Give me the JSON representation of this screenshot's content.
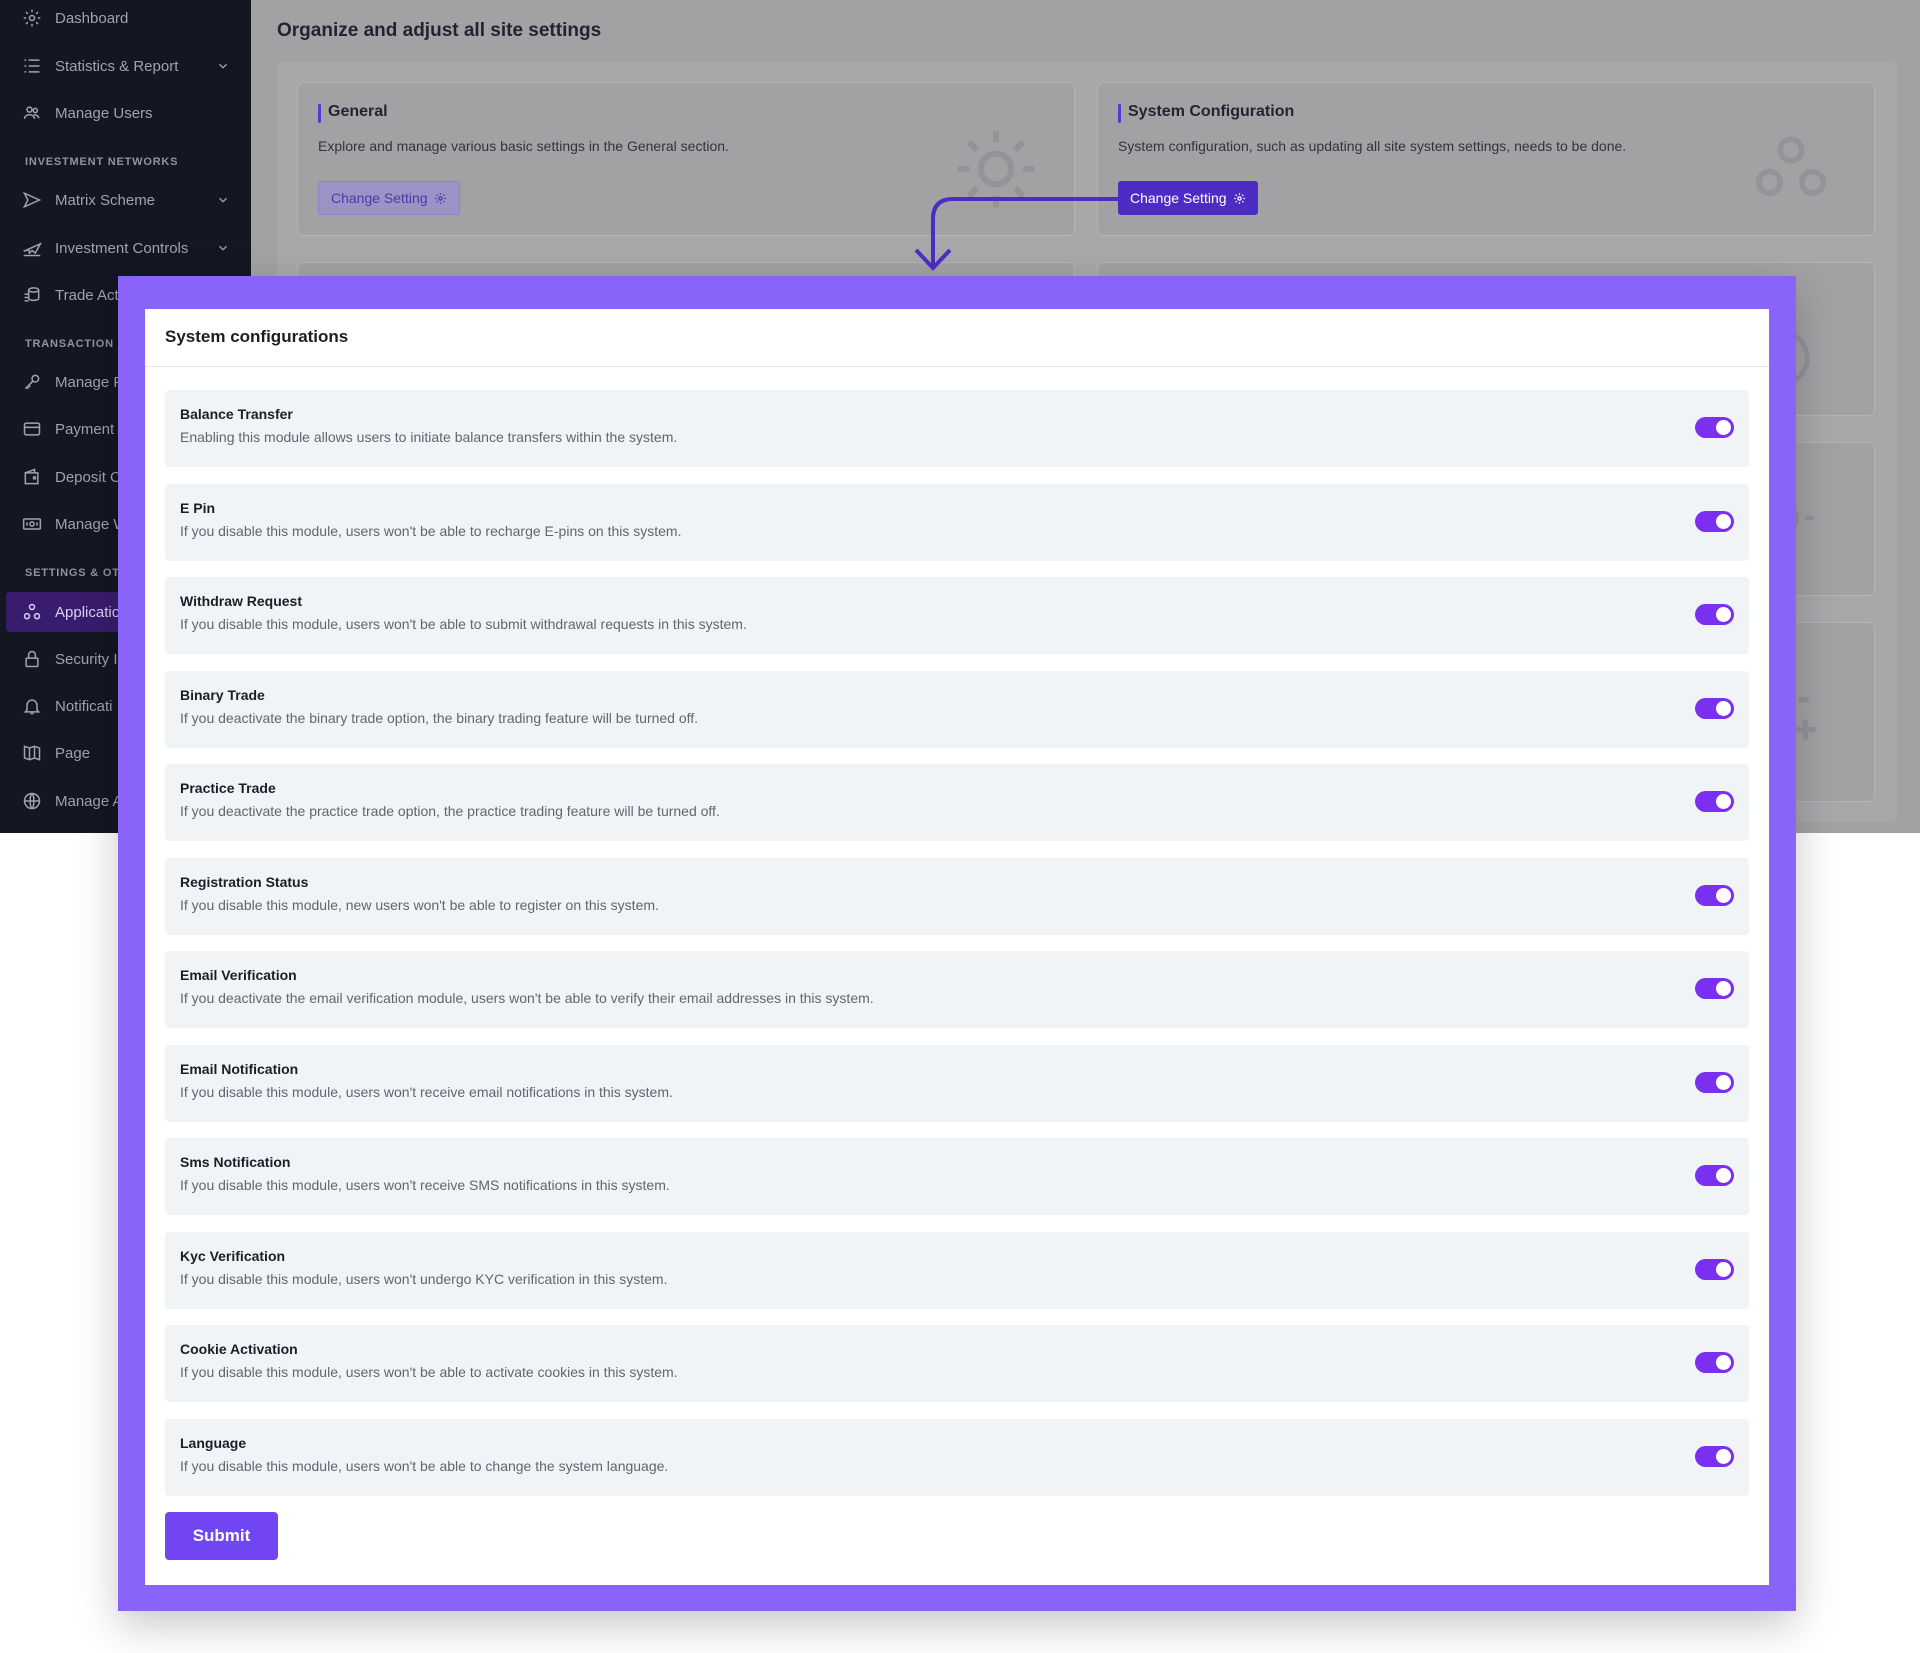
{
  "sidebar": {
    "items": [
      {
        "label": "Dashboard",
        "icon": "gear-icon",
        "chevron": false
      },
      {
        "label": "Statistics & Report",
        "icon": "list-icon",
        "chevron": true
      },
      {
        "label": "Manage Users",
        "icon": "users-icon",
        "chevron": false
      },
      {
        "label": "Matrix Scheme",
        "icon": "send-icon",
        "chevron": true
      },
      {
        "label": "Investment Controls",
        "icon": "plane-icon",
        "chevron": true
      },
      {
        "label": "Trade Act",
        "icon": "coins-icon",
        "chevron": false
      },
      {
        "label": "Manage P",
        "icon": "key-icon",
        "chevron": false
      },
      {
        "label": "Payment",
        "icon": "card-icon",
        "chevron": false
      },
      {
        "label": "Deposit C",
        "icon": "wallet-icon",
        "chevron": false
      },
      {
        "label": "Manage W",
        "icon": "cash-icon",
        "chevron": false
      },
      {
        "label": "Applicatio",
        "icon": "apps-icon",
        "chevron": false,
        "active": true
      },
      {
        "label": "Security I",
        "icon": "lock-icon",
        "chevron": false
      },
      {
        "label": "Notificati",
        "icon": "bell-icon",
        "chevron": false
      },
      {
        "label": "Page",
        "icon": "pages-icon",
        "chevron": false
      },
      {
        "label": "Manage A",
        "icon": "globe-icon",
        "chevron": false
      }
    ],
    "sections": {
      "investment": "INVESTMENT NETWORKS",
      "transaction": "TRANSACTION S",
      "settings": "SETTINGS & OTH"
    }
  },
  "main": {
    "title": "Organize and adjust all site settings",
    "cards": [
      {
        "title": "General",
        "description": "Explore and manage various basic settings in the General section.",
        "button": "Change Setting"
      },
      {
        "title": "System Configuration",
        "description": "System configuration, such as updating all site system settings, needs to be done.",
        "button": "Change Setting"
      }
    ]
  },
  "modal": {
    "title": "System configurations",
    "rows": [
      {
        "title": "Balance Transfer",
        "description": "Enabling this module allows users to initiate balance transfers within the system.",
        "enabled": true
      },
      {
        "title": "E Pin",
        "description": "If you disable this module, users won't be able to recharge E-pins on this system.",
        "enabled": true
      },
      {
        "title": "Withdraw Request",
        "description": "If you disable this module, users won't be able to submit withdrawal requests in this system.",
        "enabled": true
      },
      {
        "title": "Binary Trade",
        "description": "If you deactivate the binary trade option, the binary trading feature will be turned off.",
        "enabled": true
      },
      {
        "title": "Practice Trade",
        "description": "If you deactivate the practice trade option, the practice trading feature will be turned off.",
        "enabled": true
      },
      {
        "title": "Registration Status",
        "description": "If you disable this module, new users won't be able to register on this system.",
        "enabled": true
      },
      {
        "title": "Email Verification",
        "description": "If you deactivate the email verification module, users won't be able to verify their email addresses in this system.",
        "enabled": true
      },
      {
        "title": "Email Notification",
        "description": "If you disable this module, users won't receive email notifications in this system.",
        "enabled": true
      },
      {
        "title": "Sms Notification",
        "description": "If you disable this module, users won't receive SMS notifications in this system.",
        "enabled": true
      },
      {
        "title": "Kyc Verification",
        "description": "If you disable this module, users won't undergo KYC verification in this system.",
        "enabled": true
      },
      {
        "title": "Cookie Activation",
        "description": "If you disable this module, users won't be able to activate cookies in this system.",
        "enabled": true
      },
      {
        "title": "Language",
        "description": "If you disable this module, users won't be able to change the system language.",
        "enabled": true
      }
    ],
    "submit_label": "Submit"
  },
  "colors": {
    "accent": "#7146f2",
    "toggle_on": "#7b2ff0",
    "frame": "#8a63f8",
    "sidebar_bg": "#131722"
  }
}
